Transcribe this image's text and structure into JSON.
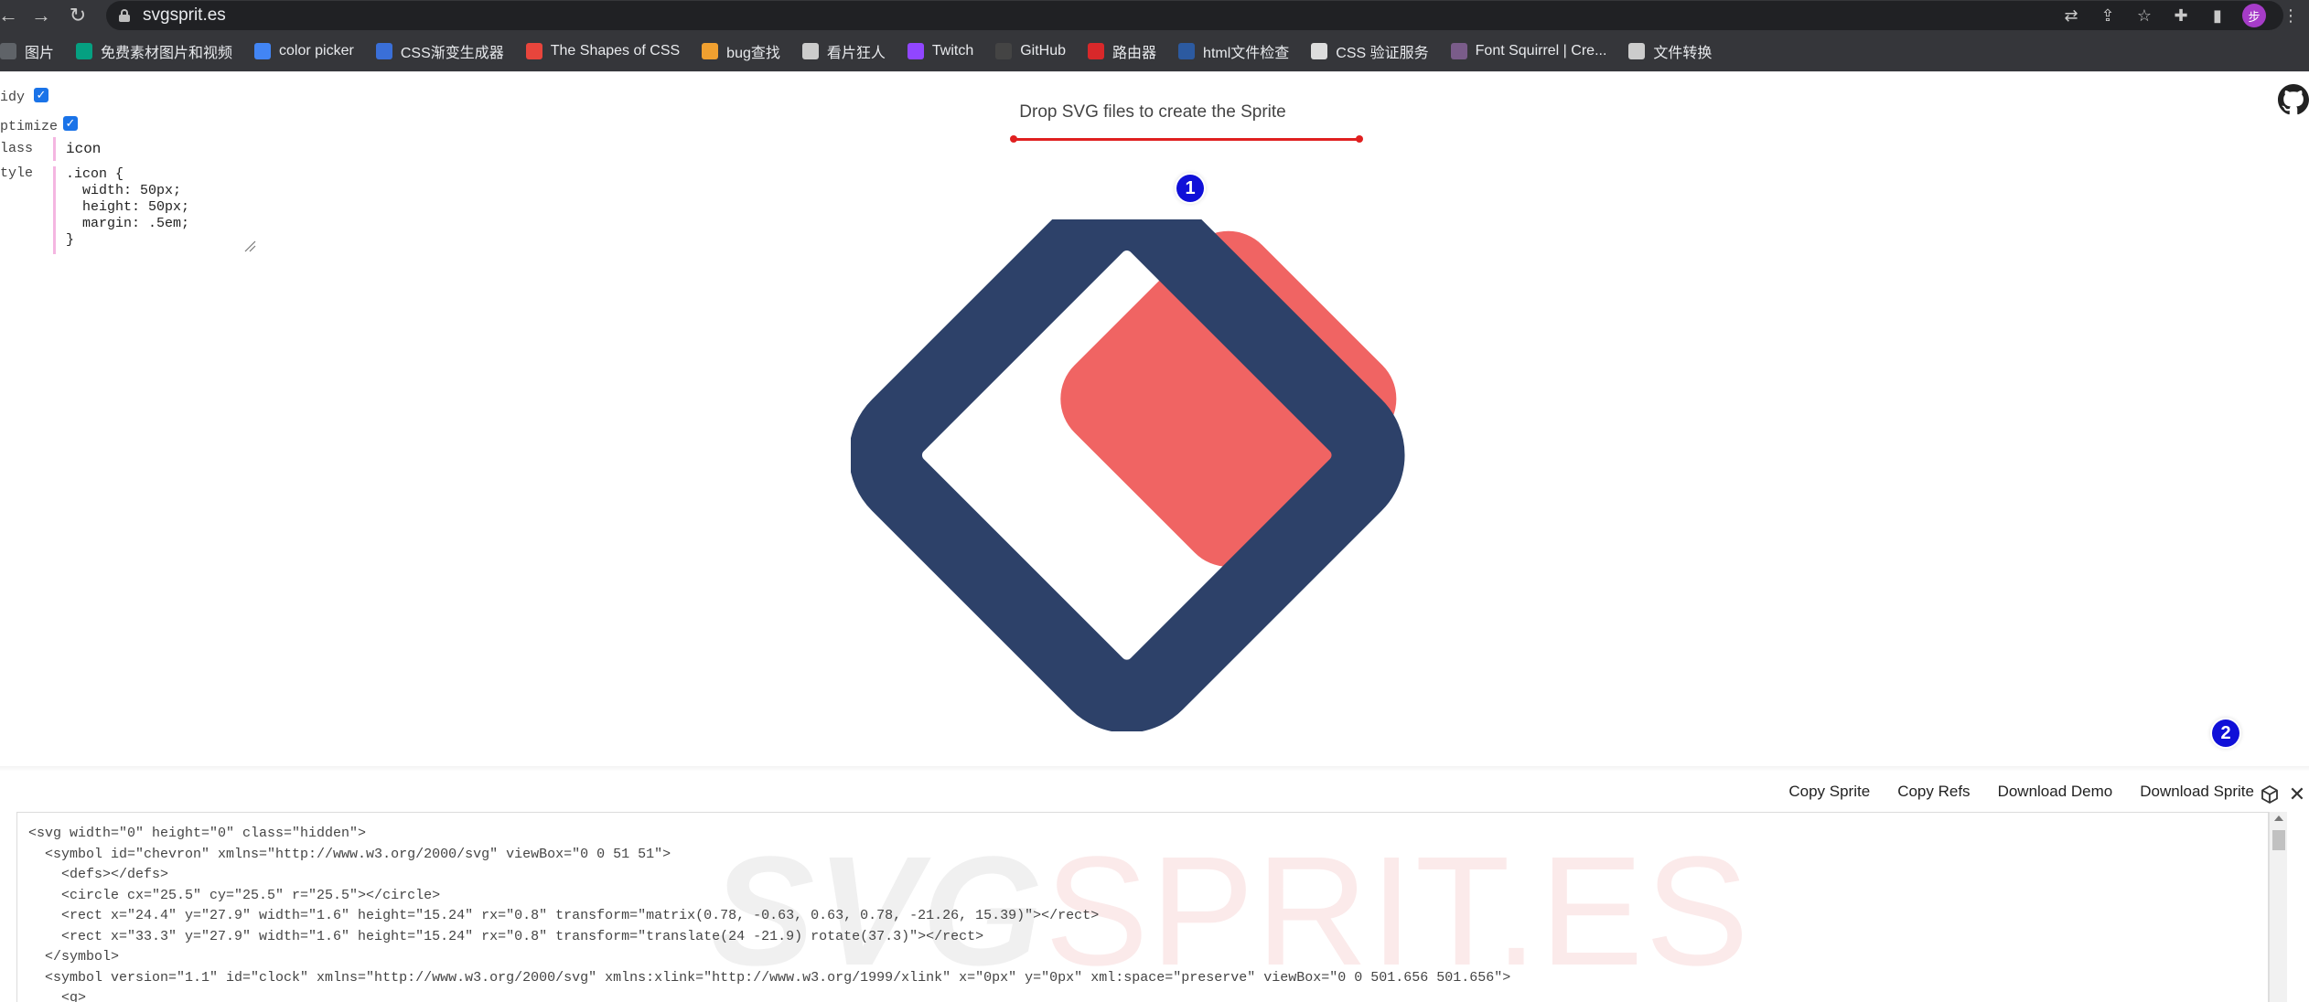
{
  "browser": {
    "url": "svgsprit.es",
    "profile_initial": "步"
  },
  "bookmarks": [
    {
      "label": "图片",
      "icon": "image-icon",
      "color": "#5f6368"
    },
    {
      "label": "免费素材图片和视频",
      "icon": "pexels-icon",
      "color": "#05a081"
    },
    {
      "label": "color picker",
      "icon": "google-icon",
      "color": "#4285f4"
    },
    {
      "label": "CSS渐变生成器",
      "icon": "gradient-icon",
      "color": "#3a6fd8"
    },
    {
      "label": "The Shapes of CSS",
      "icon": "asterisk-icon",
      "color": "#e8453c"
    },
    {
      "label": "bug查找",
      "icon": "bug-icon",
      "color": "#f0a030"
    },
    {
      "label": "看片狂人",
      "icon": "film-icon",
      "color": "#cccccc"
    },
    {
      "label": "Twitch",
      "icon": "twitch-icon",
      "color": "#9146ff"
    },
    {
      "label": "GitHub",
      "icon": "github-icon",
      "color": "#444444"
    },
    {
      "label": "路由器",
      "icon": "router-icon",
      "color": "#d8282a"
    },
    {
      "label": "html文件检查",
      "icon": "w3c-icon",
      "color": "#2c5aa0"
    },
    {
      "label": "CSS 验证服务",
      "icon": "css-validator-icon",
      "color": "#dddddd"
    },
    {
      "label": "Font Squirrel | Cre...",
      "icon": "squirrel-icon",
      "color": "#7a5c8a"
    },
    {
      "label": "文件转换",
      "icon": "cloud-icon",
      "color": "#cccccc"
    }
  ],
  "settings": {
    "tidy_label": "idy",
    "tidy_checked": true,
    "optimize_label": "ptimize",
    "optimize_checked": true,
    "class_label": "lass",
    "class_value": "icon",
    "style_label": "tyle",
    "style_value": ".icon {\n  width: 50px;\n  height: 50px;\n  margin: .5em;\n}"
  },
  "dropzone": {
    "text": "Drop SVG files to create the Sprite",
    "marker": "1"
  },
  "logo_colors": {
    "navy": "#2d4169",
    "coral": "#f06463"
  },
  "toolbar": {
    "copy_sprite": "Copy Sprite",
    "copy_refs": "Copy Refs",
    "download_demo": "Download Demo",
    "download_sprite": "Download Sprite",
    "marker": "2"
  },
  "code": {
    "watermark_a": "SVG",
    "watermark_b": "SPRIT.ES",
    "lines": [
      "<svg width=\"0\" height=\"0\" class=\"hidden\">",
      "  <symbol id=\"chevron\" xmlns=\"http://www.w3.org/2000/svg\" viewBox=\"0 0 51 51\">",
      "    <defs></defs>",
      "    <circle cx=\"25.5\" cy=\"25.5\" r=\"25.5\"></circle>",
      "    <rect x=\"24.4\" y=\"27.9\" width=\"1.6\" height=\"15.24\" rx=\"0.8\" transform=\"matrix(0.78, -0.63, 0.63, 0.78, -21.26, 15.39)\"></rect>",
      "    <rect x=\"33.3\" y=\"27.9\" width=\"1.6\" height=\"15.24\" rx=\"0.8\" transform=\"translate(24 -21.9) rotate(37.3)\"></rect>",
      "  </symbol>",
      "  <symbol version=\"1.1\" id=\"clock\" xmlns=\"http://www.w3.org/2000/svg\" xmlns:xlink=\"http://www.w3.org/1999/xlink\" x=\"0px\" y=\"0px\" xml:space=\"preserve\" viewBox=\"0 0 501.656 501.656\">",
      "    <g>"
    ]
  }
}
